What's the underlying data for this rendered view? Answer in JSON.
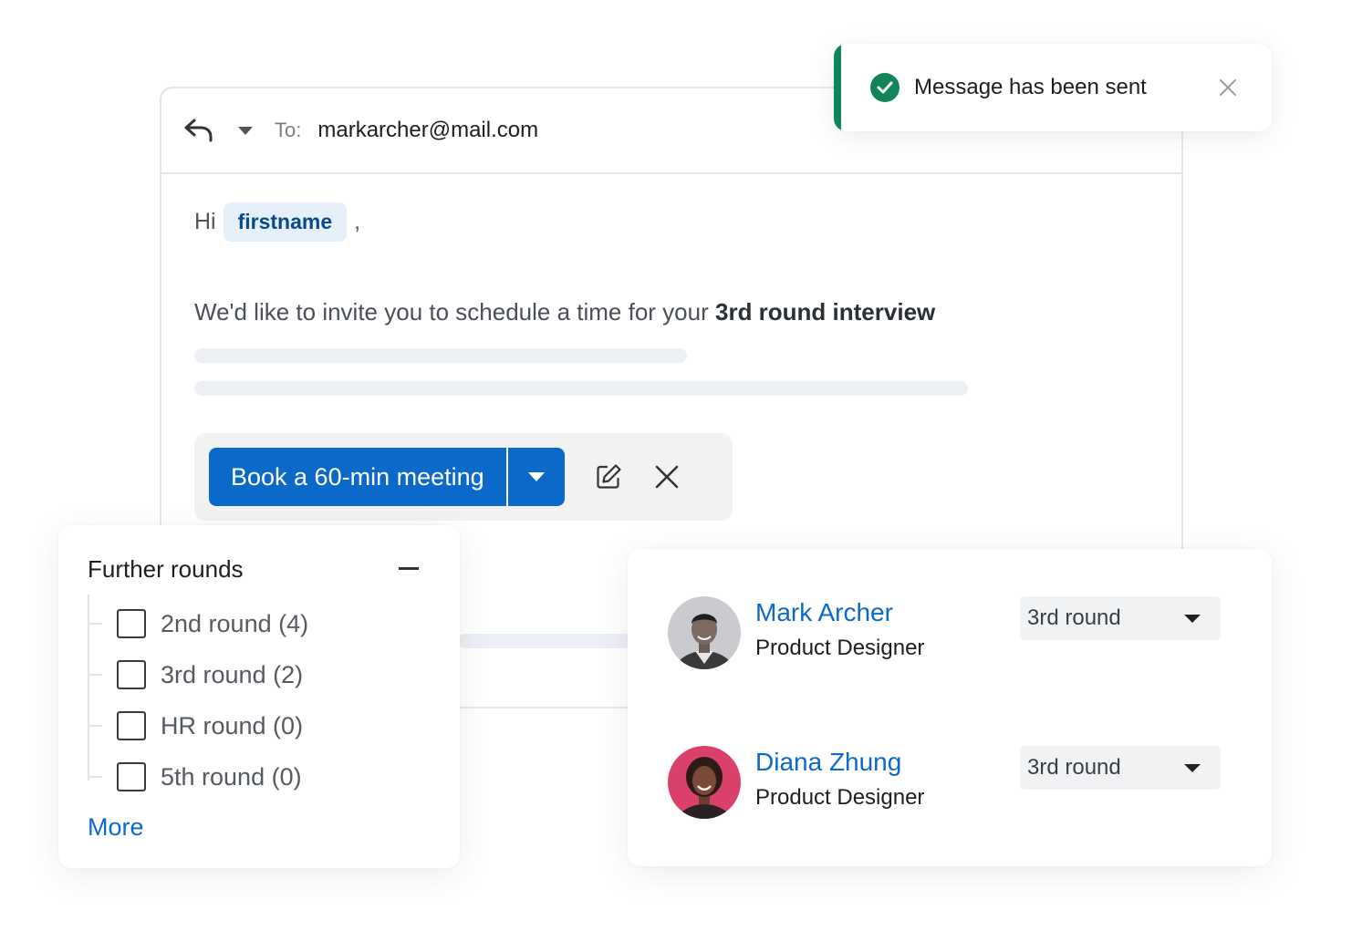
{
  "composer": {
    "to_label": "To:",
    "to_value": "markarcher@mail.com",
    "greeting": "Hi",
    "token": "firstname",
    "greeting_punct": ",",
    "invite_text": "We'd like to invite you to schedule a time for your ",
    "invite_bold": "3rd round interview",
    "meeting_button": "Book a 60-min meeting"
  },
  "toast": {
    "message": "Message has been sent",
    "accent_color": "#12845a"
  },
  "filter": {
    "title": "Further rounds",
    "options": [
      {
        "label": "2nd round (4)",
        "checked": false
      },
      {
        "label": "3rd round (2)",
        "checked": false
      },
      {
        "label": "HR round (0)",
        "checked": false
      },
      {
        "label": "5th round (0)",
        "checked": false
      }
    ],
    "more_link": "More"
  },
  "candidates": [
    {
      "name": "Mark Archer",
      "role": "Product Designer",
      "round": "3rd round",
      "avatar": "avatar-photo-man"
    },
    {
      "name": "Diana Zhung",
      "role": "Product Designer",
      "round": "3rd round",
      "avatar": "avatar-photo-woman"
    }
  ],
  "colors": {
    "primary": "#0b6ac9",
    "success": "#12845a",
    "token_bg": "#e5f0fb"
  }
}
